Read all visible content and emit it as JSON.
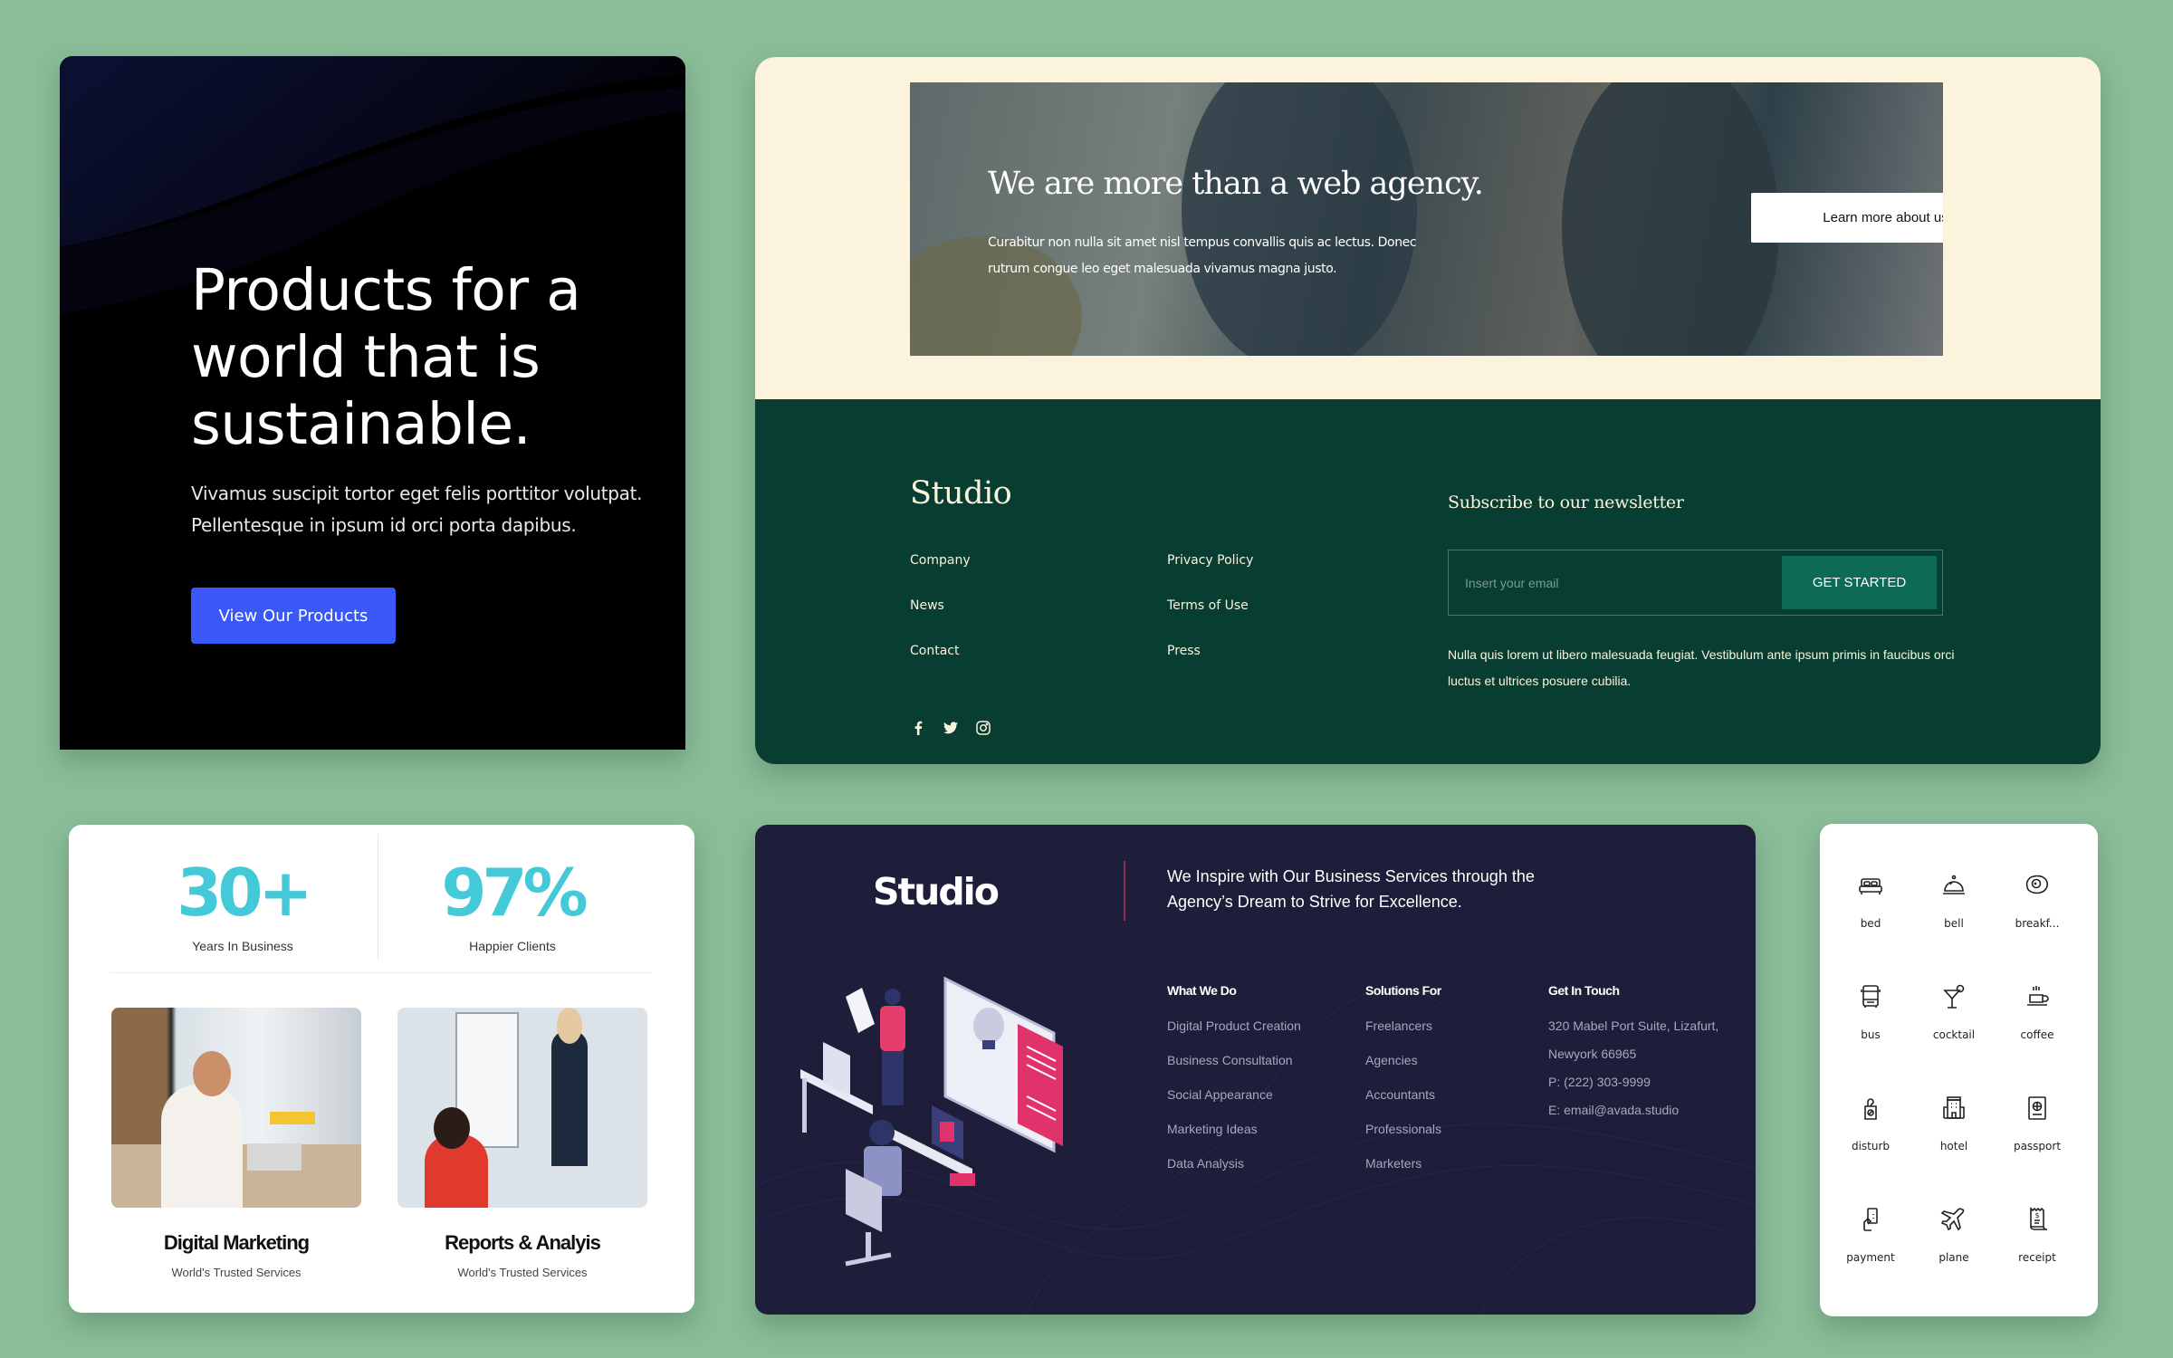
{
  "products_card": {
    "headline": "Products for a world that is sustainable.",
    "body": "Vivamus suscipit tortor eget felis porttitor volutpat. Pellentesque in ipsum id orci porta dapibus.",
    "cta_label": "View Our Products",
    "accent": "#3a57f7"
  },
  "agency_card": {
    "hero_title": "We are more than a web agency.",
    "hero_text": "Curabitur non nulla sit amet nisl tempus convallis quis ac lectus. Donec rutrum congue leo eget malesuada vivamus magna justo.",
    "hero_button": "Learn more about us",
    "logo": "Studio",
    "links_col1": [
      "Company",
      "News",
      "Contact"
    ],
    "links_col2": [
      "Privacy Policy",
      "Terms of Use",
      "Press"
    ],
    "social_icons": [
      "facebook-icon",
      "twitter-icon",
      "instagram-icon"
    ],
    "newsletter_title": "Subscribe to our newsletter",
    "email_placeholder": "Insert your email",
    "newsletter_button": "GET STARTED",
    "newsletter_text": "Nulla quis lorem ut libero malesuada feugiat. Vestibulum ante ipsum primis in faucibus orci luctus et ultrices posuere cubilia.",
    "colors": {
      "cream": "#fcf3dc",
      "dark_green": "#083d32",
      "button_green": "#0d6a57"
    }
  },
  "stats_card": {
    "stats": [
      {
        "value": "30+",
        "label": "Years In Business"
      },
      {
        "value": "97%",
        "label": "Happier Clients"
      }
    ],
    "services": [
      {
        "title": "Digital Marketing",
        "subtitle": "World's Trusted Services"
      },
      {
        "title": "Reports & Analyis",
        "subtitle": "World's Trusted Services"
      }
    ],
    "accent": "#44c9d9"
  },
  "dark_card": {
    "logo": "Studio",
    "tagline": "We Inspire with Our Business Services through the Agency’s Dream to Strive for Excellence.",
    "columns": [
      {
        "heading": "What We Do",
        "items": [
          "Digital Product Creation",
          "Business Consultation",
          "Social Appearance",
          "Marketing Ideas",
          "Data Analysis"
        ]
      },
      {
        "heading": "Solutions For",
        "items": [
          "Freelancers",
          "Agencies",
          "Accountants",
          "Professionals",
          "Marketers"
        ]
      },
      {
        "heading": "Get In Touch",
        "items": [
          "320 Mabel Port Suite, Lizafurt,",
          "Newyork 66965",
          "P: (222) 303-9999",
          "E: email@avada.studio"
        ]
      }
    ]
  },
  "icons_card": {
    "icons": [
      {
        "name": "bed",
        "label": "bed"
      },
      {
        "name": "bell",
        "label": "bell"
      },
      {
        "name": "breakfast",
        "label": "breakf..."
      },
      {
        "name": "bus",
        "label": "bus"
      },
      {
        "name": "cocktail",
        "label": "cocktail"
      },
      {
        "name": "coffee",
        "label": "coffee"
      },
      {
        "name": "disturb",
        "label": "disturb"
      },
      {
        "name": "hotel",
        "label": "hotel"
      },
      {
        "name": "passport",
        "label": "passport"
      },
      {
        "name": "payment",
        "label": "payment"
      },
      {
        "name": "plane",
        "label": "plane"
      },
      {
        "name": "receipt",
        "label": "receipt"
      }
    ]
  }
}
